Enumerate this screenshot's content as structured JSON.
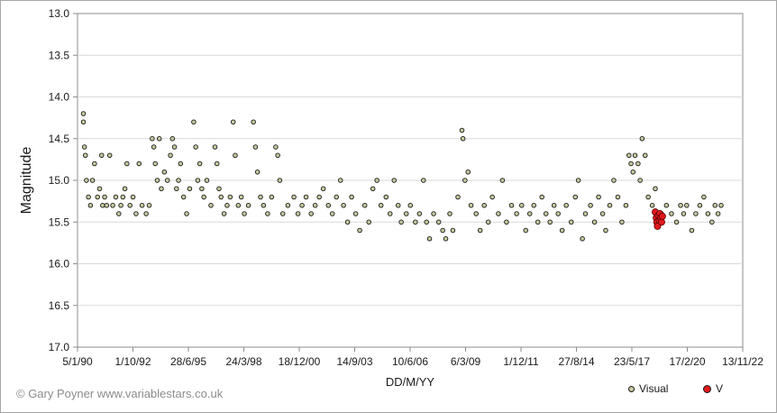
{
  "credit": "© Gary Poyner  www.variablestars.co.uk",
  "chart_data": {
    "type": "scatter",
    "xlabel": "DD/M/YY",
    "ylabel": "Magnitude",
    "x_ticks": [
      "5/1/90",
      "1/10/92",
      "28/6/95",
      "24/3/98",
      "18/12/00",
      "14/9/03",
      "10/6/06",
      "6/3/09",
      "1/12/11",
      "27/8/14",
      "23/5/17",
      "17/2/20",
      "13/11/22"
    ],
    "x_range_years": [
      1990.01,
      2022.87
    ],
    "ylim": [
      13.0,
      17.0
    ],
    "y_ticks": [
      "13.0",
      "13.5",
      "14.0",
      "14.5",
      "15.0",
      "15.5",
      "16.0",
      "16.5",
      "17.0"
    ],
    "y_inverted": true,
    "grid": "horizontal",
    "legend_position": "bottom-right",
    "series": [
      {
        "name": "Visual",
        "color": "#c9c9a0",
        "points": [
          [
            1990.3,
            14.2
          ],
          [
            1990.3,
            14.3
          ],
          [
            1990.35,
            14.6
          ],
          [
            1990.4,
            14.7
          ],
          [
            1990.45,
            15.0
          ],
          [
            1990.55,
            15.2
          ],
          [
            1990.65,
            15.3
          ],
          [
            1990.75,
            15.0
          ],
          [
            1990.85,
            14.8
          ],
          [
            1991.0,
            15.2
          ],
          [
            1991.1,
            15.1
          ],
          [
            1991.2,
            14.7
          ],
          [
            1991.25,
            15.3
          ],
          [
            1991.35,
            15.2
          ],
          [
            1991.45,
            15.3
          ],
          [
            1991.6,
            14.7
          ],
          [
            1991.75,
            15.3
          ],
          [
            1991.9,
            15.2
          ],
          [
            1992.05,
            15.4
          ],
          [
            1992.15,
            15.3
          ],
          [
            1992.25,
            15.2
          ],
          [
            1992.35,
            15.1
          ],
          [
            1992.45,
            14.8
          ],
          [
            1992.6,
            15.3
          ],
          [
            1992.75,
            15.2
          ],
          [
            1992.9,
            15.4
          ],
          [
            1993.05,
            14.8
          ],
          [
            1993.2,
            15.3
          ],
          [
            1993.4,
            15.4
          ],
          [
            1993.55,
            15.3
          ],
          [
            1993.7,
            14.5
          ],
          [
            1993.78,
            14.6
          ],
          [
            1993.85,
            14.8
          ],
          [
            1993.95,
            15.0
          ],
          [
            1994.05,
            14.5
          ],
          [
            1994.15,
            15.1
          ],
          [
            1994.3,
            14.9
          ],
          [
            1994.45,
            15.0
          ],
          [
            1994.6,
            14.7
          ],
          [
            1994.7,
            14.5
          ],
          [
            1994.8,
            14.6
          ],
          [
            1994.9,
            15.1
          ],
          [
            1995.0,
            15.0
          ],
          [
            1995.1,
            14.8
          ],
          [
            1995.25,
            15.2
          ],
          [
            1995.4,
            15.4
          ],
          [
            1995.55,
            15.1
          ],
          [
            1995.75,
            14.3
          ],
          [
            1995.85,
            14.6
          ],
          [
            1995.95,
            15.0
          ],
          [
            1996.05,
            14.8
          ],
          [
            1996.15,
            15.1
          ],
          [
            1996.25,
            15.2
          ],
          [
            1996.4,
            15.0
          ],
          [
            1996.6,
            15.3
          ],
          [
            1996.8,
            14.6
          ],
          [
            1996.9,
            14.8
          ],
          [
            1997.0,
            15.1
          ],
          [
            1997.1,
            15.2
          ],
          [
            1997.25,
            15.4
          ],
          [
            1997.4,
            15.3
          ],
          [
            1997.55,
            15.2
          ],
          [
            1997.7,
            14.3
          ],
          [
            1997.8,
            14.7
          ],
          [
            1997.95,
            15.3
          ],
          [
            1998.1,
            15.2
          ],
          [
            1998.25,
            15.4
          ],
          [
            1998.45,
            15.3
          ],
          [
            1998.7,
            14.3
          ],
          [
            1998.8,
            14.6
          ],
          [
            1998.9,
            14.9
          ],
          [
            1999.05,
            15.2
          ],
          [
            1999.2,
            15.3
          ],
          [
            1999.4,
            15.4
          ],
          [
            1999.6,
            15.2
          ],
          [
            1999.8,
            14.6
          ],
          [
            1999.9,
            14.7
          ],
          [
            2000.0,
            15.0
          ],
          [
            2000.15,
            15.4
          ],
          [
            2000.4,
            15.3
          ],
          [
            2000.7,
            15.2
          ],
          [
            2000.9,
            15.4
          ],
          [
            2001.1,
            15.3
          ],
          [
            2001.3,
            15.2
          ],
          [
            2001.55,
            15.4
          ],
          [
            2001.75,
            15.3
          ],
          [
            2001.95,
            15.2
          ],
          [
            2002.15,
            15.1
          ],
          [
            2002.4,
            15.3
          ],
          [
            2002.6,
            15.4
          ],
          [
            2002.8,
            15.2
          ],
          [
            2003.0,
            15.0
          ],
          [
            2003.15,
            15.3
          ],
          [
            2003.35,
            15.5
          ],
          [
            2003.55,
            15.2
          ],
          [
            2003.75,
            15.4
          ],
          [
            2003.95,
            15.6
          ],
          [
            2004.2,
            15.3
          ],
          [
            2004.4,
            15.5
          ],
          [
            2004.6,
            15.1
          ],
          [
            2004.8,
            15.0
          ],
          [
            2005.0,
            15.3
          ],
          [
            2005.25,
            15.2
          ],
          [
            2005.45,
            15.4
          ],
          [
            2005.65,
            15.0
          ],
          [
            2005.85,
            15.3
          ],
          [
            2006.0,
            15.5
          ],
          [
            2006.25,
            15.4
          ],
          [
            2006.45,
            15.3
          ],
          [
            2006.7,
            15.5
          ],
          [
            2006.9,
            15.4
          ],
          [
            2007.1,
            15.0
          ],
          [
            2007.25,
            15.5
          ],
          [
            2007.4,
            15.7
          ],
          [
            2007.6,
            15.4
          ],
          [
            2007.85,
            15.5
          ],
          [
            2008.05,
            15.6
          ],
          [
            2008.2,
            15.7
          ],
          [
            2008.4,
            15.4
          ],
          [
            2008.55,
            15.6
          ],
          [
            2008.8,
            15.2
          ],
          [
            2009.0,
            14.4
          ],
          [
            2009.05,
            14.5
          ],
          [
            2009.15,
            15.0
          ],
          [
            2009.3,
            14.9
          ],
          [
            2009.45,
            15.3
          ],
          [
            2009.7,
            15.4
          ],
          [
            2009.9,
            15.6
          ],
          [
            2010.1,
            15.3
          ],
          [
            2010.3,
            15.5
          ],
          [
            2010.5,
            15.2
          ],
          [
            2010.8,
            15.4
          ],
          [
            2011.0,
            15.0
          ],
          [
            2011.2,
            15.5
          ],
          [
            2011.45,
            15.3
          ],
          [
            2011.7,
            15.4
          ],
          [
            2011.95,
            15.3
          ],
          [
            2012.15,
            15.6
          ],
          [
            2012.35,
            15.4
          ],
          [
            2012.55,
            15.3
          ],
          [
            2012.75,
            15.5
          ],
          [
            2012.95,
            15.2
          ],
          [
            2013.15,
            15.4
          ],
          [
            2013.35,
            15.5
          ],
          [
            2013.55,
            15.3
          ],
          [
            2013.75,
            15.4
          ],
          [
            2013.95,
            15.6
          ],
          [
            2014.15,
            15.3
          ],
          [
            2014.4,
            15.5
          ],
          [
            2014.6,
            15.2
          ],
          [
            2014.75,
            15.0
          ],
          [
            2014.95,
            15.7
          ],
          [
            2015.1,
            15.4
          ],
          [
            2015.35,
            15.3
          ],
          [
            2015.55,
            15.5
          ],
          [
            2015.75,
            15.2
          ],
          [
            2015.95,
            15.4
          ],
          [
            2016.1,
            15.6
          ],
          [
            2016.3,
            15.3
          ],
          [
            2016.5,
            15.0
          ],
          [
            2016.7,
            15.2
          ],
          [
            2016.9,
            15.5
          ],
          [
            2017.1,
            15.3
          ],
          [
            2017.25,
            14.7
          ],
          [
            2017.35,
            14.8
          ],
          [
            2017.45,
            14.9
          ],
          [
            2017.55,
            14.7
          ],
          [
            2017.7,
            14.8
          ],
          [
            2017.8,
            15.0
          ],
          [
            2017.9,
            14.5
          ],
          [
            2018.05,
            14.7
          ],
          [
            2018.2,
            15.2
          ],
          [
            2018.4,
            15.3
          ],
          [
            2018.55,
            15.1
          ],
          [
            2018.7,
            15.4
          ],
          [
            2018.85,
            15.4
          ],
          [
            2019.1,
            15.3
          ],
          [
            2019.35,
            15.4
          ],
          [
            2019.6,
            15.5
          ],
          [
            2019.8,
            15.3
          ],
          [
            2019.95,
            15.4
          ],
          [
            2020.1,
            15.3
          ],
          [
            2020.35,
            15.6
          ],
          [
            2020.55,
            15.4
          ],
          [
            2020.75,
            15.3
          ],
          [
            2020.95,
            15.2
          ],
          [
            2021.15,
            15.4
          ],
          [
            2021.35,
            15.5
          ],
          [
            2021.5,
            15.3
          ],
          [
            2021.65,
            15.4
          ],
          [
            2021.8,
            15.3
          ]
        ]
      },
      {
        "name": "V",
        "color": "#e3191c",
        "points": [
          [
            2018.55,
            15.38
          ],
          [
            2018.6,
            15.45
          ],
          [
            2018.63,
            15.5
          ],
          [
            2018.66,
            15.55
          ],
          [
            2018.7,
            15.42
          ],
          [
            2018.75,
            15.48
          ],
          [
            2018.78,
            15.4
          ],
          [
            2018.82,
            15.45
          ],
          [
            2018.86,
            15.5
          ],
          [
            2018.9,
            15.43
          ]
        ]
      }
    ]
  }
}
